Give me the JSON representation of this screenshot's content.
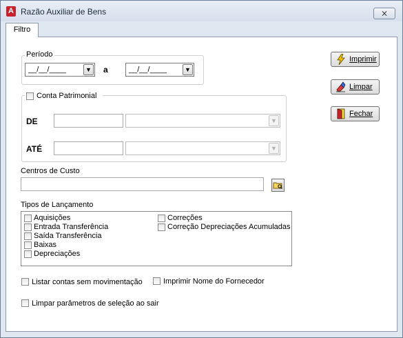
{
  "window": {
    "title": "Razão Auxiliar de Bens",
    "close_symbol": "⨯",
    "app_icon": "app-logo-icon"
  },
  "tabs": [
    {
      "label": "Filtro"
    }
  ],
  "periodo": {
    "label": "Período",
    "from_value": "__/__/____",
    "separator": "a",
    "to_value": "__/__/____"
  },
  "conta": {
    "checkbox_label": "Conta Patrimonial",
    "de_label": "DE",
    "ate_label": "ATÉ"
  },
  "centros": {
    "label": "Centros de Custo"
  },
  "tipos": {
    "label": "Tipos de Lançamento",
    "left_items": [
      "Aquisições",
      "Entrada Transferência",
      "Saída Transferência",
      "Baixas",
      "Depreciações"
    ],
    "right_items": [
      "Correções",
      "Correção Depreciações Acumuladas"
    ]
  },
  "options": {
    "listar_label": "Listar contas sem movimentação",
    "imprimir_nome_label": "Imprimir Nome do Fornecedor",
    "limpar_label": "Limpar parâmetros de seleção ao sair"
  },
  "buttons": {
    "imprimir": "Imprimir",
    "limpar": "Limpar",
    "fechar": "Fechar"
  },
  "icons": {
    "imprimir": "lightning-icon",
    "limpar": "eraser-icon",
    "fechar": "door-exit-icon",
    "folder": "folder-search-icon",
    "dropdown": "chevron-down-icon"
  }
}
